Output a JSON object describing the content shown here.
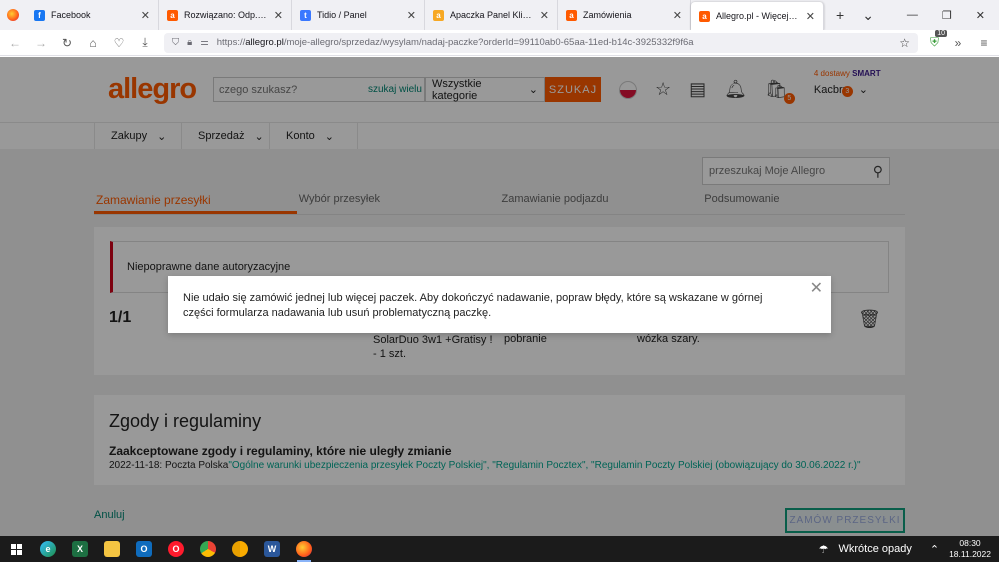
{
  "browser": {
    "tabs": [
      {
        "label": "Facebook",
        "favicon": "facebook-icon",
        "color": "#1877f2",
        "glyph": "f",
        "active": false
      },
      {
        "label": "Rozwiązano: Odp.: Poczta w",
        "favicon": "allegro-icon",
        "color": "#ff5a00",
        "glyph": "a",
        "active": false
      },
      {
        "label": "Tidio / Panel",
        "favicon": "tidio-icon",
        "color": "#3a78ff",
        "glyph": "t",
        "active": false
      },
      {
        "label": "Apaczka Panel Klienta",
        "favicon": "apaczka-icon",
        "color": "#f7a823",
        "glyph": "a",
        "active": false
      },
      {
        "label": "Zamówienia",
        "favicon": "allegro-icon",
        "color": "#ff5a00",
        "glyph": "a",
        "active": false
      },
      {
        "label": "Allegro.pl - Więcej niż aukc",
        "favicon": "allegro-icon",
        "color": "#ff5a00",
        "glyph": "a",
        "active": true
      }
    ],
    "url_scheme": "https://",
    "url_host": "allegro.pl",
    "url_path": "/moje-allegro/sprzedaz/wysylam/nadaj-paczke?orderId=99110ab0-65aa-11ed-b14c-3925332f9f6a",
    "extension_badge": "10"
  },
  "header": {
    "logo": "allegro",
    "search_placeholder": "czego szukasz?",
    "search_many": "szukaj wielu",
    "category": "Wszystkie kategorie",
    "search_button": "SZUKAJ",
    "cart_badge": "5",
    "smart_text": "4 dostawy",
    "smart_brand": "SMART",
    "account_name": "Kacbru",
    "account_badge": "3"
  },
  "menu": [
    "Zakupy",
    "Sprzedaż",
    "Konto"
  ],
  "side_search_placeholder": "przeszukaj Moje Allegro",
  "steps": [
    "Zamawianie przesyłki",
    "Wybór przesyłek",
    "Zamawianie podjazdu",
    "Podsumowanie"
  ],
  "alert_text": "Niepoprawne dane autoryzacyjne",
  "counter": "1/1",
  "row": {
    "product": "SolarDuo 3w1 +Gratisy ! - 1 szt.",
    "payment": "pobranie",
    "desc": "wózka szary."
  },
  "consents": {
    "heading": "Zgody i regulaminy",
    "subheading": "Zaakceptowane zgody i regulaminy, które nie uległy zmianie",
    "prefix": "2022-11-18: Poczta Polska",
    "links": "\"Ogólne warunki ubezpieczenia przesyłek Poczty Polskiej\", \"Regulamin Pocztex\", \"Regulamin Poczty Polskiej (obowiązujący do 30.06.2022 r.)\""
  },
  "cancel_link": "Anuluj",
  "order_button": "ZAMÓW PRZESYŁKI",
  "modal_text": "Nie udało się zamówić jednej lub więcej paczek. Aby dokończyć nadawanie, popraw błędy, które są wskazane w górnej części formularza nadawania lub usuń problematyczną paczkę.",
  "taskbar": {
    "weather": "Wkrótce opady",
    "time": "08:30",
    "date": "18.11.2022"
  }
}
